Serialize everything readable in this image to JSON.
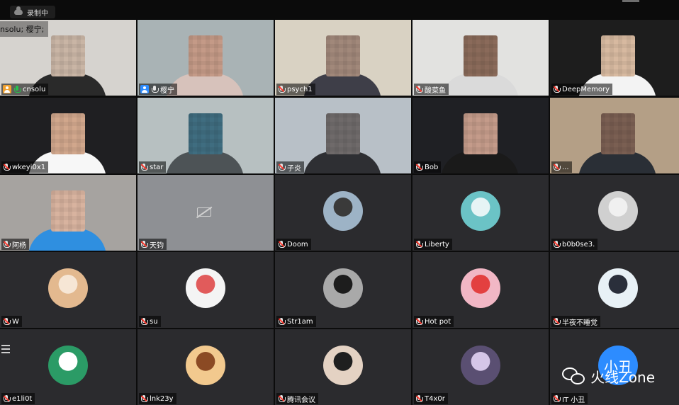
{
  "recording_label": "录制中",
  "tiles": [
    {
      "name": "cnsolu",
      "type": "video",
      "mic": "live",
      "host": "orange",
      "active": true,
      "bg": "#d6d3cf",
      "face": "#c9b5a5",
      "torso": "#2a2a2a",
      "caption": "nsolu; 樱宁;"
    },
    {
      "name": "樱宁",
      "type": "video",
      "mic": "normal",
      "host": "blue",
      "bg": "#a9b3b5",
      "face": "#c49a87",
      "torso": "#d7c2bb"
    },
    {
      "name": "psych1",
      "type": "video",
      "mic": "muted",
      "bg": "#d9d2c3",
      "face": "#a1887a",
      "torso": "#3e3e48"
    },
    {
      "name": "酸菜鱼",
      "type": "video",
      "mic": "muted",
      "bg": "#e2e2e0",
      "face": "#8a6a5a",
      "torso": "#dadada"
    },
    {
      "name": "DeepMemory",
      "type": "video",
      "mic": "muted",
      "bg": "#1d1d1d",
      "face": "#d7b9a0",
      "torso": "#f3f3f3"
    },
    {
      "name": "wkeyi0x1",
      "type": "video",
      "mic": "muted",
      "bg": "#1f1f22",
      "face": "#d1a78c",
      "torso": "#f7f7f7"
    },
    {
      "name": "star",
      "type": "video",
      "mic": "muted",
      "bg": "#b7c0c1",
      "face": "#3f6d80",
      "torso": "#4d5356"
    },
    {
      "name": "子炎",
      "type": "video",
      "mic": "muted",
      "bg": "#b8c0c7",
      "face": "#6f6a6a",
      "torso": "#2e2f33"
    },
    {
      "name": "Bob",
      "type": "video",
      "mic": "muted",
      "bg": "#1f2024",
      "face": "#c49b8a",
      "torso": "#1a1a1a"
    },
    {
      "name": "...",
      "type": "video",
      "mic": "muted",
      "bg": "#b49f86",
      "face": "#7a5f52",
      "torso": "#2a2f36"
    },
    {
      "name": "阿杨",
      "type": "video",
      "mic": "muted",
      "bg": "#a6a3a0",
      "face": "#d8b39f",
      "torso": "#2f8fe0"
    },
    {
      "name": "天钧",
      "type": "camoff",
      "mic": "muted",
      "bg": "#8e9094"
    },
    {
      "name": "Doom",
      "type": "avatar",
      "mic": "muted",
      "avatar_bg": "#9db3c6",
      "avatar_fg": "#3a3a3a"
    },
    {
      "name": "Liberty",
      "type": "avatar",
      "mic": "muted",
      "avatar_bg": "#6bc3c6",
      "avatar_fg": "#e6f4f5"
    },
    {
      "name": "b0b0se3.",
      "type": "avatar",
      "mic": "muted",
      "avatar_bg": "#d0d0d0",
      "avatar_fg": "#f0f0f0"
    },
    {
      "name": "W",
      "type": "avatar",
      "mic": "muted",
      "avatar_bg": "#e3b98f",
      "avatar_fg": "#f6e6d5"
    },
    {
      "name": "su",
      "type": "avatar",
      "mic": "muted",
      "avatar_bg": "#f4f4f4",
      "avatar_fg": "#e15b5b"
    },
    {
      "name": "Str1am",
      "type": "avatar",
      "mic": "muted",
      "avatar_bg": "#a9a9a9",
      "avatar_fg": "#1d1d1d"
    },
    {
      "name": "Hot pot",
      "type": "avatar",
      "mic": "muted",
      "avatar_bg": "#f1b7c5",
      "avatar_fg": "#e34040"
    },
    {
      "name": "半夜不睡觉",
      "type": "avatar",
      "mic": "muted",
      "avatar_bg": "#e8f1f6",
      "avatar_fg": "#2a2f3b"
    },
    {
      "name": "e1li0t",
      "type": "avatar",
      "mic": "muted",
      "avatar_bg": "#2b9b66",
      "avatar_fg": "#ffffff",
      "list_icon": true
    },
    {
      "name": "lnk23y",
      "type": "avatar",
      "mic": "muted",
      "avatar_bg": "#f2c98e",
      "avatar_fg": "#8b4a24"
    },
    {
      "name": "腾讯会议",
      "type": "avatar",
      "mic": "muted",
      "avatar_bg": "#e4d2c3",
      "avatar_fg": "#1f1f1f"
    },
    {
      "name": "T4x0r",
      "type": "avatar",
      "mic": "muted",
      "avatar_bg": "#5a4f72",
      "avatar_fg": "#d5c6e8"
    },
    {
      "name": "IT 小丑",
      "type": "avatar_text",
      "mic": "muted",
      "avatar_bg": "#2d8cff",
      "avatar_text": "小丑"
    }
  ],
  "watermark": {
    "text": "火线Zone",
    "icon": "wechat-icon"
  }
}
